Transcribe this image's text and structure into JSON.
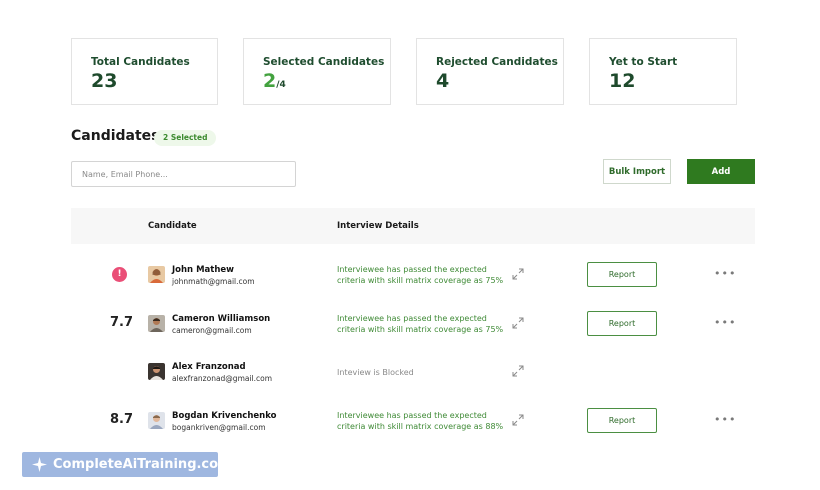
{
  "stats": [
    {
      "label": "Total Candidates",
      "value": "23"
    },
    {
      "label": "Selected Candidates",
      "value": "2",
      "sub": "/4"
    },
    {
      "label": "Rejected Candidates",
      "value": "4"
    },
    {
      "label": "Yet to Start",
      "value": "12"
    }
  ],
  "section": {
    "title": "Candidates",
    "badge": "2 Selected"
  },
  "search": {
    "placeholder": "Name, Email Phone..."
  },
  "actions": {
    "bulk_import": "Bulk Import",
    "add": "Add"
  },
  "table": {
    "headers": {
      "candidate": "Candidate",
      "interview": "Interview Details"
    },
    "rows": [
      {
        "score": "",
        "alert": "!",
        "name": "John Mathew",
        "email": "johnmath@gmail.com",
        "detail": "Interviewee has passed the expected criteria with skill matrix coverage as 75%",
        "report": "Report",
        "more": "•••"
      },
      {
        "score": "7.7",
        "alert": "",
        "name": "Cameron Williamson",
        "email": "cameron@gmail.com",
        "detail": "Interviewee has passed the expected criteria with skill matrix coverage as 75%",
        "report": "Report",
        "more": "•••"
      },
      {
        "score": "",
        "alert": "",
        "name": "Alex Franzonad",
        "email": "alexfranzonad@gmail.com",
        "detail": "Inteview is Blocked",
        "report": "",
        "more": ""
      },
      {
        "score": "8.7",
        "alert": "",
        "name": "Bogdan Krivenchenko",
        "email": "bogankriven@gmail.com",
        "detail": "Interviewee has passed the expected criteria with skill matrix coverage as 88%",
        "report": "Report",
        "more": "•••"
      }
    ]
  },
  "watermark": {
    "text": "CompleteAiTraining.com"
  },
  "colors": {
    "accent": "#2f7a1f",
    "success_text": "#3f8a36",
    "alert": "#ea4f77"
  }
}
